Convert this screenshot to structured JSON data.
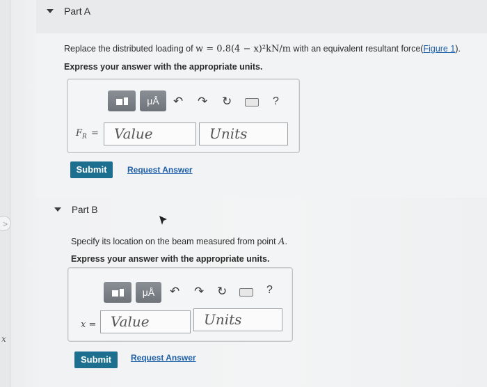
{
  "part_a": {
    "title": "Part A",
    "question_prefix": "Replace the distributed loading of ",
    "question_formula": "w = 0.8(4 − x)²kN/m",
    "question_middle": " with an equivalent resultant force(",
    "figure_link": "Figure 1",
    "question_suffix": ").",
    "instruction": "Express your answer with the appropriate units.",
    "variable": "F",
    "variable_sub": "R",
    "equals": "=",
    "value_placeholder": "Value",
    "units_placeholder": "Units",
    "submit_label": "Submit",
    "request_label": "Request Answer"
  },
  "part_b": {
    "title": "Part B",
    "question_prefix": "Specify its location on the beam measured from point ",
    "question_point": "A",
    "question_suffix": ".",
    "instruction": "Express your answer with the appropriate units.",
    "variable": "x",
    "equals": "=",
    "value_placeholder": "Value",
    "units_placeholder": "Units",
    "submit_label": "Submit",
    "request_label": "Request Answer"
  },
  "toolbar": {
    "mu_label": "μÅ",
    "undo_glyph": "↶",
    "redo_glyph": "↷",
    "reset_glyph": "↻",
    "help_glyph": "?"
  },
  "side": {
    "chevron": ">",
    "x_mark": "x"
  },
  "colors": {
    "submit": "#1d6f8f",
    "link": "#1d5fa8",
    "toolbar_button": "#7a7f86"
  }
}
